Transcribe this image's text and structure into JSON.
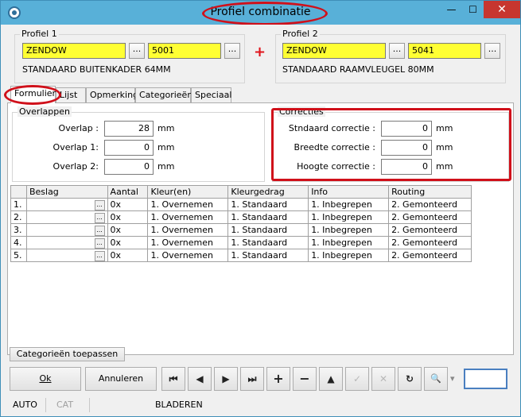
{
  "window": {
    "title": "Profiel combinatie",
    "minimize": "—",
    "maximize": "☐",
    "close": "✕"
  },
  "profiel1": {
    "label": "Profiel 1",
    "supplier": "ZENDOW",
    "code": "5001",
    "description": "STANDAARD BUITENKADER 64MM",
    "lookup": "..."
  },
  "combine_symbol": "+",
  "profiel2": {
    "label": "Profiel 2",
    "supplier": "ZENDOW",
    "code": "5041",
    "description": "STANDAARD RAAMVLEUGEL 80MM",
    "lookup": "..."
  },
  "tabs": [
    "Formulier",
    "Lijst",
    "Opmerking",
    "Categorieën",
    "Speciaal"
  ],
  "overlappen": {
    "title": "Overlappen",
    "rows": [
      {
        "label": "Overlap :",
        "value": "28",
        "unit": "mm"
      },
      {
        "label": "Overlap 1:",
        "value": "0",
        "unit": "mm"
      },
      {
        "label": "Overlap 2:",
        "value": "0",
        "unit": "mm"
      }
    ]
  },
  "correcties": {
    "title": "Correcties",
    "rows": [
      {
        "label": "Stndaard correctie :",
        "value": "0",
        "unit": "mm"
      },
      {
        "label": "Breedte correctie :",
        "value": "0",
        "unit": "mm"
      },
      {
        "label": "Hoogte correctie :",
        "value": "0",
        "unit": "mm"
      }
    ]
  },
  "table": {
    "columns": [
      "Beslag",
      "Aantal",
      "Kleur(en)",
      "Kleurgedrag",
      "Info",
      "Routing"
    ],
    "rows": [
      {
        "nr": "1.",
        "beslag": "",
        "aantal": "0x",
        "kleur": "1. Overnemen",
        "kleurgedrag": "1. Standaard",
        "info": "1. Inbegrepen",
        "routing": "2. Gemonteerd"
      },
      {
        "nr": "2.",
        "beslag": "",
        "aantal": "0x",
        "kleur": "1. Overnemen",
        "kleurgedrag": "1. Standaard",
        "info": "1. Inbegrepen",
        "routing": "2. Gemonteerd"
      },
      {
        "nr": "3.",
        "beslag": "",
        "aantal": "0x",
        "kleur": "1. Overnemen",
        "kleurgedrag": "1. Standaard",
        "info": "1. Inbegrepen",
        "routing": "2. Gemonteerd"
      },
      {
        "nr": "4.",
        "beslag": "",
        "aantal": "0x",
        "kleur": "1. Overnemen",
        "kleurgedrag": "1. Standaard",
        "info": "1. Inbegrepen",
        "routing": "2. Gemonteerd"
      },
      {
        "nr": "5.",
        "beslag": "",
        "aantal": "0x",
        "kleur": "1. Overnemen",
        "kleurgedrag": "1. Standaard",
        "info": "1. Inbegrepen",
        "routing": "2. Gemonteerd"
      }
    ]
  },
  "buttons": {
    "apply_categories": "Categorieën toepassen",
    "ok": "Ok",
    "cancel": "Annuleren"
  },
  "nav": {
    "first": "⏮",
    "prev": "◀",
    "next": "▶",
    "last": "⏭",
    "add": "+",
    "delete": "−",
    "up": "▲",
    "confirm": "✓",
    "cancel": "✕",
    "refresh": "↻",
    "search": "🔍",
    "dropdown": "▾"
  },
  "status": {
    "mode1": "AUTO",
    "mode2": "CAT",
    "state": "BLADEREN"
  },
  "colors": {
    "highlight": "#d0101a",
    "yellow_field": "#ffff33",
    "titlebar": "#58b0d8"
  }
}
